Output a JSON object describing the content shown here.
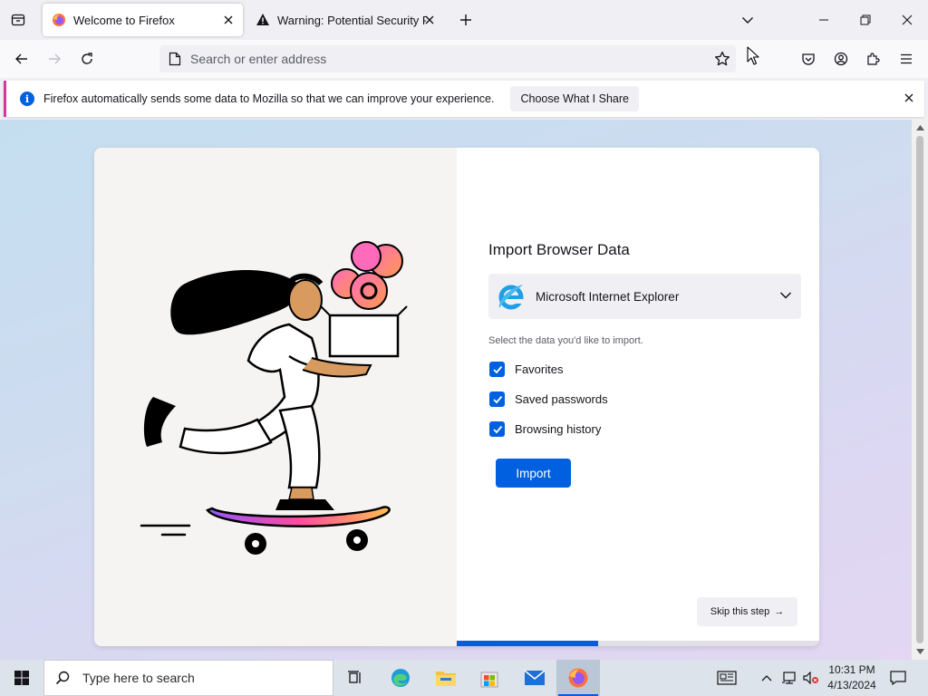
{
  "tabs": [
    {
      "label": "Welcome to Firefox",
      "active": true
    },
    {
      "label": "Warning: Potential Security Risk Ahead",
      "active": false
    }
  ],
  "urlbar": {
    "placeholder": "Search or enter address"
  },
  "notification": {
    "message": "Firefox automatically sends some data to Mozilla so that we can improve your experience.",
    "button": "Choose What I Share"
  },
  "import": {
    "title": "Import Browser Data",
    "selected_browser": "Microsoft Internet Explorer",
    "hint": "Select the data you'd like to import.",
    "options": [
      {
        "label": "Favorites",
        "checked": true
      },
      {
        "label": "Saved passwords",
        "checked": true
      },
      {
        "label": "Browsing history",
        "checked": true
      }
    ],
    "import_button": "Import",
    "skip_button": "Skip this step",
    "skip_arrow": "→",
    "progress": 0.39
  },
  "taskbar": {
    "search_placeholder": "Type here to search",
    "time": "10:31 PM",
    "date": "4/13/2024"
  },
  "colors": {
    "accent": "#0060df",
    "notification_border": "#d5379a"
  },
  "icons": {
    "firefox_view": "firefox-view-icon",
    "new_tab": "plus-icon",
    "list_tabs": "chevron-down-icon",
    "back": "back-arrow-icon",
    "forward": "forward-arrow-icon",
    "reload": "reload-icon",
    "bookmark": "star-icon",
    "pocket": "pocket-icon",
    "account": "account-icon",
    "extensions": "puzzle-icon",
    "menu": "hamburger-icon"
  }
}
